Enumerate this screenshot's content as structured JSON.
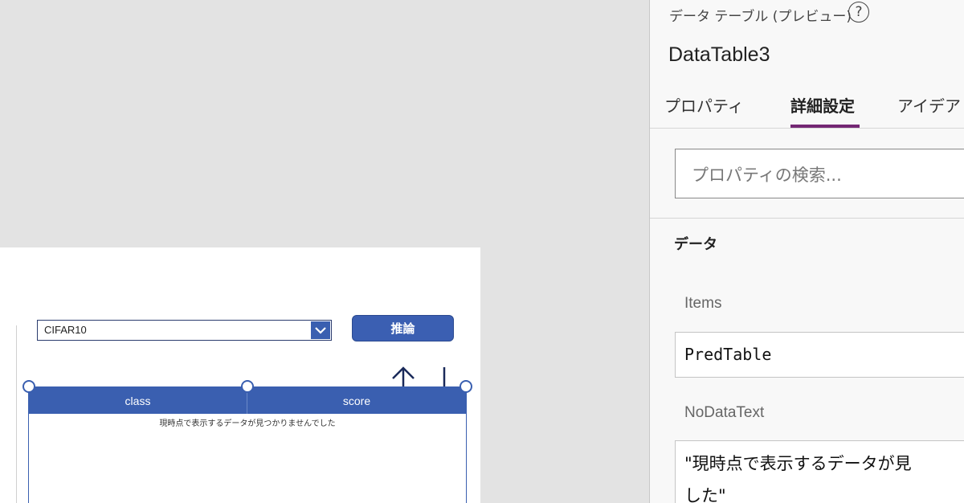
{
  "canvas": {
    "dropdown": {
      "value": "CIFAR10"
    },
    "infer_button": {
      "label": "推論"
    },
    "data_table": {
      "columns": [
        "class",
        "score"
      ],
      "no_data_text": "現時点で表示するデータが見つかりませんでした"
    }
  },
  "panel": {
    "control_type": "データ テーブル (プレビュー)",
    "help_glyph": "?",
    "control_name": "DataTable3",
    "tabs": [
      {
        "label": "プロパティ",
        "active": false
      },
      {
        "label": "詳細設定",
        "active": true
      },
      {
        "label": "アイデア",
        "active": false
      }
    ],
    "search_placeholder": "プロパティの検索...",
    "section_title": "データ",
    "items_label": "Items",
    "items_value": "PredTable",
    "nodatatext_label": "NoDataText",
    "nodatatext_line1": "\"現時点で表示するデータが見",
    "nodatatext_line2": "した\""
  },
  "colors": {
    "accent": "#3a5fb0",
    "tab_underline": "#742774",
    "arrow": "#1a2a5a"
  }
}
